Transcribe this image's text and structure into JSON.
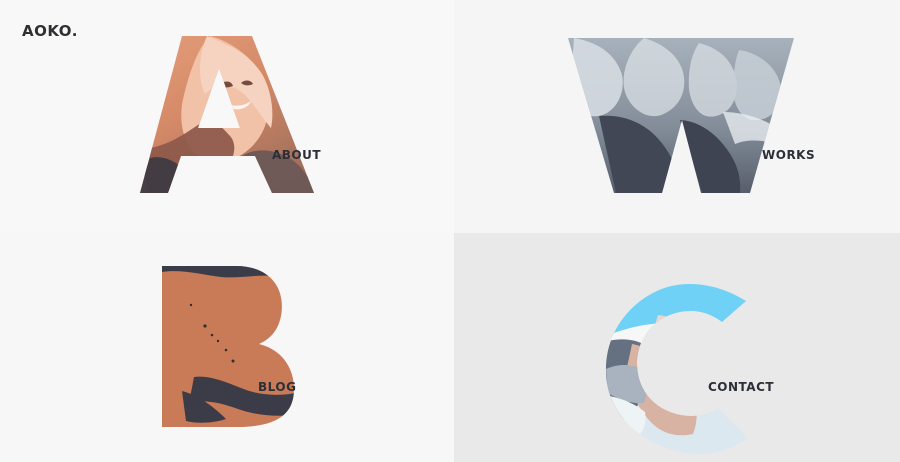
{
  "brand": {
    "name": "AOKO."
  },
  "nav": {
    "about": "ABOUT",
    "works": "WORKS",
    "blog": "BLOG",
    "contact": "CONTACT"
  },
  "colors": {
    "text": "#2f3033",
    "about_skin": "#e8a98a",
    "works_gray": "#8a96a3",
    "blog_orange": "#c97b57",
    "contact_blue": "#66c7f0",
    "dark_navy": "#3b3c48"
  }
}
